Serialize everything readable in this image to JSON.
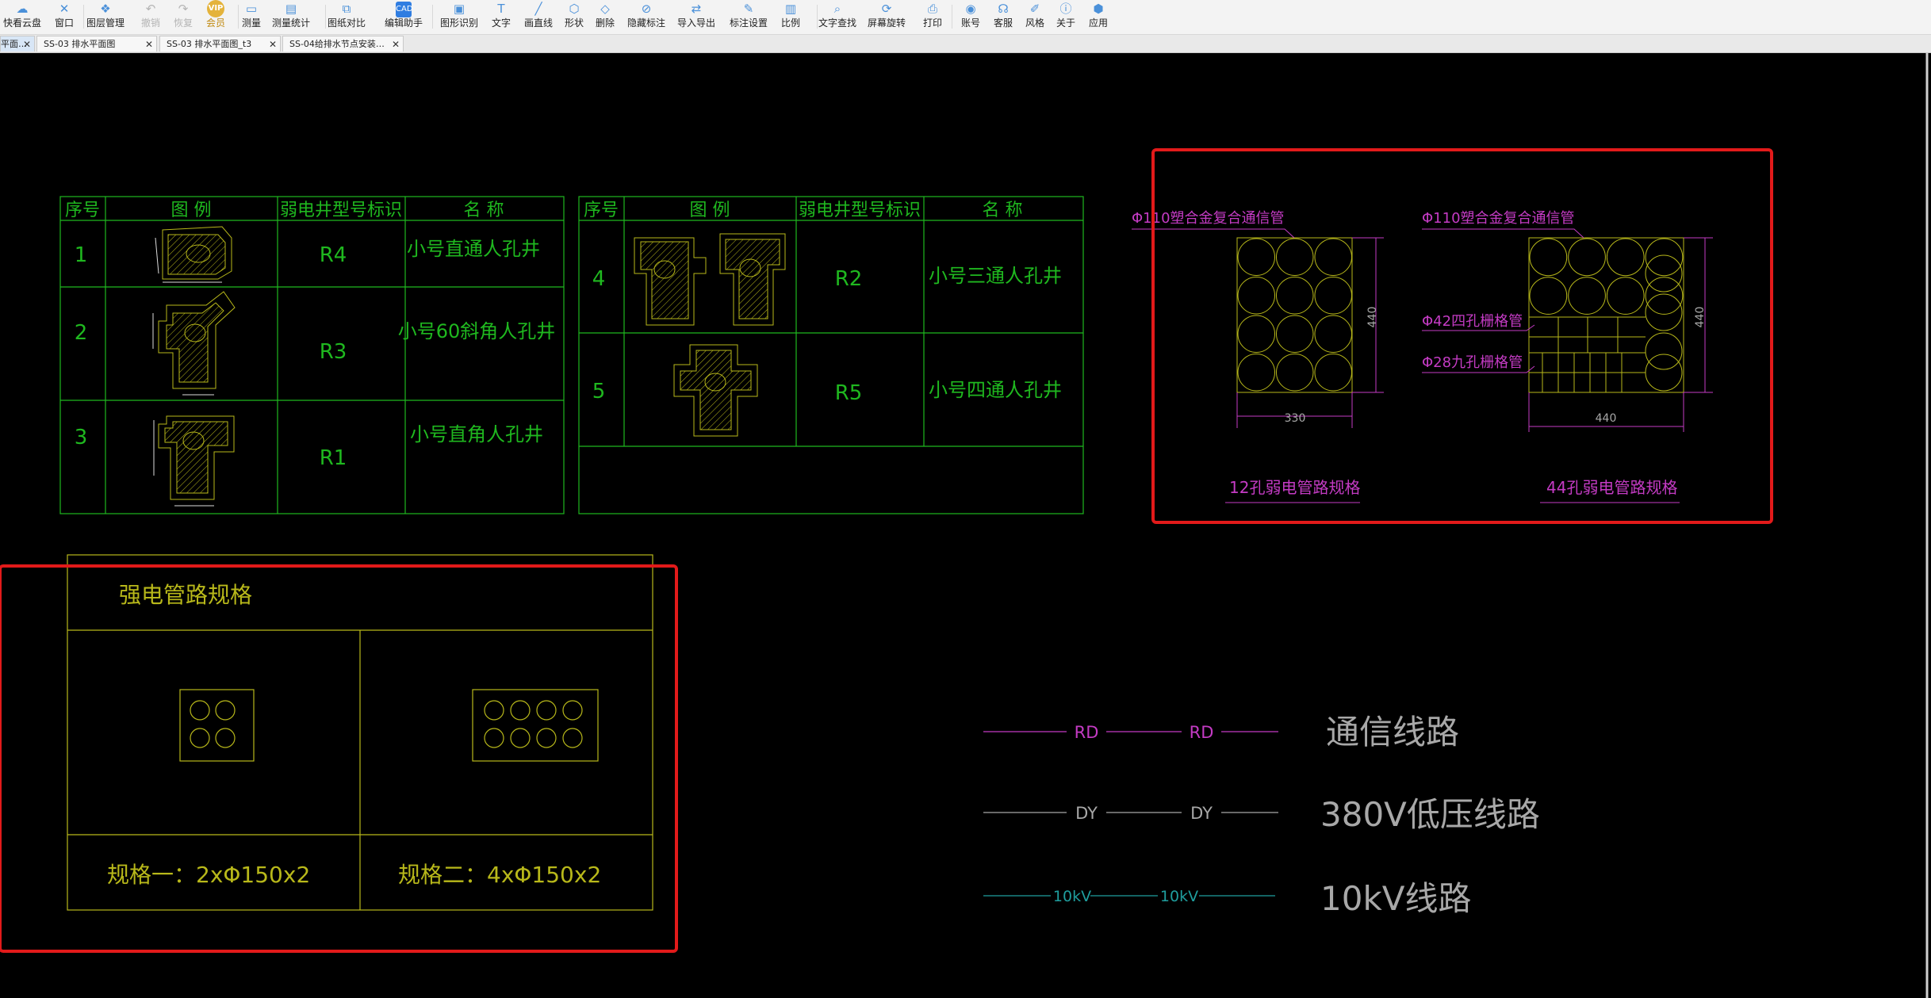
{
  "toolbar": {
    "items": [
      {
        "label": "快看云盘",
        "icon": "cloud-icon"
      },
      {
        "label": "窗口",
        "icon": "window-icon"
      },
      {
        "label": "图层管理",
        "icon": "layers-icon"
      },
      {
        "label": "撤销",
        "icon": "undo-icon"
      },
      {
        "label": "恢复",
        "icon": "redo-icon"
      },
      {
        "label": "会员",
        "icon": "vip-icon",
        "badge": "VIP"
      },
      {
        "label": "测量",
        "icon": "measure-icon"
      },
      {
        "label": "测量统计",
        "icon": "measure-stats-icon"
      },
      {
        "label": "图纸对比",
        "icon": "compare-icon"
      },
      {
        "label": "编辑助手",
        "icon": "edit-helper-icon",
        "badge": "CAD"
      },
      {
        "label": "图形识别",
        "icon": "shape-recognize-icon"
      },
      {
        "label": "文字",
        "icon": "text-icon"
      },
      {
        "label": "画直线",
        "icon": "line-icon"
      },
      {
        "label": "形状",
        "icon": "shape-icon"
      },
      {
        "label": "删除",
        "icon": "eraser-icon"
      },
      {
        "label": "隐藏标注",
        "icon": "hide-annotation-icon"
      },
      {
        "label": "导入导出",
        "icon": "import-export-icon"
      },
      {
        "label": "标注设置",
        "icon": "annotation-settings-icon"
      },
      {
        "label": "比例",
        "icon": "scale-icon"
      },
      {
        "label": "文字查找",
        "icon": "text-search-icon"
      },
      {
        "label": "屏幕旋转",
        "icon": "rotate-screen-icon"
      },
      {
        "label": "打印",
        "icon": "print-icon"
      },
      {
        "label": "账号",
        "icon": "account-icon"
      },
      {
        "label": "客服",
        "icon": "headset-icon"
      },
      {
        "label": "风格",
        "icon": "style-icon"
      },
      {
        "label": "关于",
        "icon": "info-icon"
      },
      {
        "label": "应用",
        "icon": "apps-icon"
      }
    ]
  },
  "tabs": [
    {
      "label": "平面…"
    },
    {
      "label": "SS-03 排水平面图"
    },
    {
      "label": "SS-03 排水平面图_t3"
    },
    {
      "label": "SS-04给排水节点安装…"
    }
  ],
  "drawing": {
    "table_left": {
      "headers": [
        "序号",
        "图 例",
        "弱电井型号标识",
        "名 称"
      ],
      "rows": [
        {
          "no": "1",
          "code": "R4",
          "name": "小号直通人孔井"
        },
        {
          "no": "2",
          "code": "R3",
          "name": "小号60斜角人孔井"
        },
        {
          "no": "3",
          "code": "R1",
          "name": "小号直角人孔井"
        }
      ]
    },
    "table_right": {
      "headers": [
        "序号",
        "图 例",
        "弱电井型号标识",
        "名 称"
      ],
      "rows": [
        {
          "no": "4",
          "code": "R2",
          "name": "小号三通人孔井"
        },
        {
          "no": "5",
          "code": "R5",
          "name": "小号四通人孔井"
        }
      ]
    },
    "duct_spec": {
      "left_label": "Φ110塑合金复合通信管",
      "left_width": "330",
      "left_height": "440",
      "left_caption": "12孔弱电管路规格",
      "right_label": "Φ110塑合金复合通信管",
      "right_label_2": "Φ42四孔栅格管",
      "right_label_3": "Φ28九孔栅格管",
      "right_width": "440",
      "right_height": "440",
      "right_caption": "44孔弱电管路规格"
    },
    "strong_duct": {
      "title": "强电管路规格",
      "spec_1": "规格一：2xΦ150x2",
      "spec_2": "规格二：4xΦ150x2"
    },
    "legend": [
      {
        "tag": "RD",
        "label": "通信线路",
        "color": "#c43bc4"
      },
      {
        "tag": "DY",
        "label": "380V低压线路",
        "color": "#a8a8a8"
      },
      {
        "tag": "10kV",
        "label": "10kV线路",
        "color": "#1f9e9e"
      }
    ]
  },
  "colors": {
    "cad_green": "#1fb81f",
    "cad_yellow": "#b8b81a",
    "cad_magenta": "#c43bc4",
    "highlight_red": "#e21a1a"
  }
}
